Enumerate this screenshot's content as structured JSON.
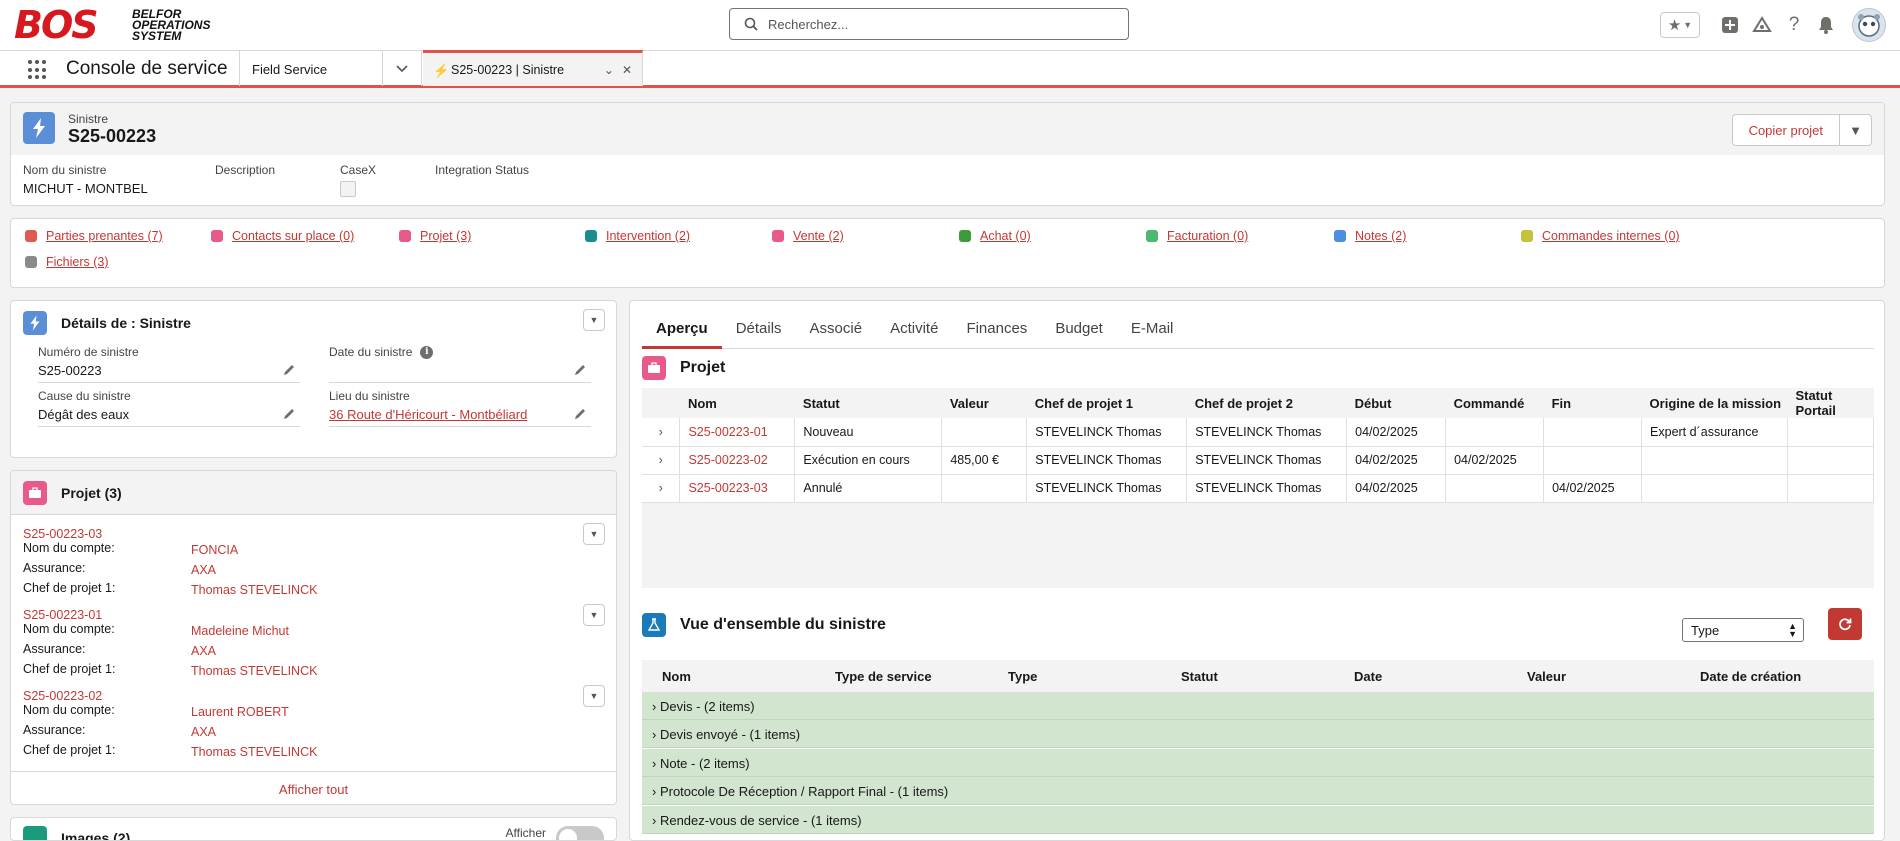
{
  "brand": {
    "mark": "BOS",
    "line1": "BELFOR",
    "line2": "OPERATIONS",
    "line3": "SYSTEM"
  },
  "search": {
    "placeholder": "Recherchez..."
  },
  "nav": {
    "app_name": "Console de service",
    "tab1": "Field Service",
    "tab2": "S25-00223 | Sinistre"
  },
  "record": {
    "type": "Sinistre",
    "name": "S25-00223",
    "copy_button": "Copier projet",
    "fields": [
      {
        "label": "Nom du sinistre",
        "value": "MICHUT - MONTBEL"
      },
      {
        "label": "Description",
        "value": ""
      },
      {
        "label": "CaseX",
        "value": ""
      },
      {
        "label": "Integration Status",
        "value": ""
      }
    ]
  },
  "related": [
    {
      "label": "Parties prenantes (7)",
      "color": "#e05b4f"
    },
    {
      "label": "Contacts sur place (0)",
      "color": "#e85a8a"
    },
    {
      "label": "Projet (3)",
      "color": "#e85a8a"
    },
    {
      "label": "Intervention (2)",
      "color": "#1a8e8e"
    },
    {
      "label": "Vente (2)",
      "color": "#e85a8a"
    },
    {
      "label": "Achat (0)",
      "color": "#3c9c3c"
    },
    {
      "label": "Facturation (0)",
      "color": "#4bb870"
    },
    {
      "label": "Notes (2)",
      "color": "#4a8fe0"
    },
    {
      "label": "Commandes internes (0)",
      "color": "#c4c43c"
    },
    {
      "label": "Fichiers (3)",
      "color": "#8a8a8a"
    }
  ],
  "details": {
    "title": "Détails de : Sinistre",
    "fields": [
      {
        "label": "Numéro de sinistre",
        "value": "S25-00223"
      },
      {
        "label": "Date du sinistre",
        "value": ""
      },
      {
        "label": "Cause du sinistre",
        "value": "Dégât des eaux"
      },
      {
        "label": "Lieu du sinistre",
        "value": "36 Route d'Héricourt - Montbéliard"
      }
    ]
  },
  "projets": {
    "title": "Projet (3)",
    "labels": {
      "account": "Nom du compte:",
      "insurance": "Assurance:",
      "manager": "Chef de projet 1:"
    },
    "items": [
      {
        "id": "S25-00223-03",
        "account": "FONCIA",
        "insurance": "AXA",
        "manager": "Thomas STEVELINCK"
      },
      {
        "id": "S25-00223-01",
        "account": "Madeleine Michut",
        "insurance": "AXA",
        "manager": "Thomas STEVELINCK"
      },
      {
        "id": "S25-00223-02",
        "account": "Laurent ROBERT",
        "insurance": "AXA",
        "manager": "Thomas STEVELINCK"
      }
    ],
    "show_all": "Afficher tout"
  },
  "images": {
    "title": "Images (2)",
    "toggle_label": "Afficher"
  },
  "tabs": [
    "Aperçu",
    "Détails",
    "Associé",
    "Activité",
    "Finances",
    "Budget",
    "E-Mail"
  ],
  "project_table": {
    "title": "Projet",
    "columns": [
      "Nom",
      "Statut",
      "Valeur",
      "Chef de projet 1",
      "Chef de projet 2",
      "Début",
      "Commandé",
      "Fin",
      "Origine de la mission",
      "Statut Portail"
    ],
    "rows": [
      [
        "S25-00223-01",
        "Nouveau",
        "",
        "STEVELINCK Thomas",
        "STEVELINCK Thomas",
        "04/02/2025",
        "",
        "",
        "Expert d´assurance",
        ""
      ],
      [
        "S25-00223-02",
        "Exécution en cours",
        "485,00 €",
        "STEVELINCK Thomas",
        "STEVELINCK Thomas",
        "04/02/2025",
        "04/02/2025",
        "",
        "",
        ""
      ],
      [
        "S25-00223-03",
        "Annulé",
        "",
        "STEVELINCK Thomas",
        "STEVELINCK Thomas",
        "04/02/2025",
        "",
        "04/02/2025",
        "",
        ""
      ]
    ]
  },
  "overview": {
    "title": "Vue d'ensemble du sinistre",
    "select_value": "Type",
    "columns": [
      "Nom",
      "Type de service",
      "Type",
      "Statut",
      "Date",
      "Valeur",
      "Date de création"
    ],
    "groups": [
      "Devis - (2 items)",
      "Devis envoyé - (1 items)",
      "Note - (2 items)",
      "Protocole De Réception / Rapport Final - (1 items)",
      "Rendez-vous de service - (1 items)"
    ]
  }
}
